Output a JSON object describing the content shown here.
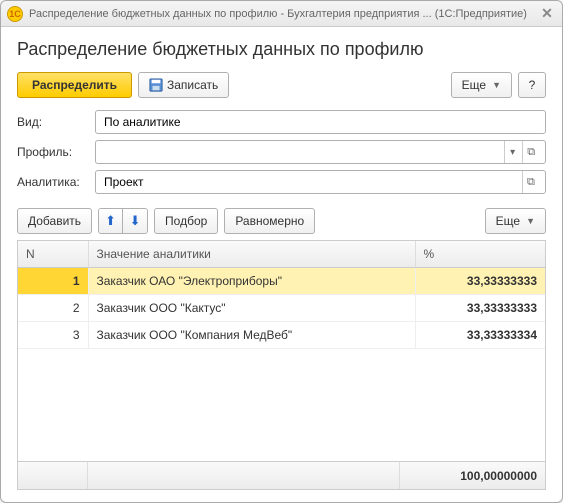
{
  "window": {
    "title": "Распределение бюджетных данных по профилю - Бухгалтерия предприятия ... (1С:Предприятие)",
    "logo_text": "1C"
  },
  "page": {
    "title": "Распределение бюджетных данных по профилю"
  },
  "toolbar": {
    "distribute": "Распределить",
    "save": "Записать",
    "more": "Еще",
    "help": "?"
  },
  "form": {
    "kind_label": "Вид:",
    "kind_value": "По аналитике",
    "profile_label": "Профиль:",
    "profile_value": "",
    "analytics_label": "Аналитика:",
    "analytics_value": "Проект"
  },
  "table_toolbar": {
    "add": "Добавить",
    "select": "Подбор",
    "evenly": "Равномерно",
    "more": "Еще"
  },
  "table": {
    "headers": {
      "n": "N",
      "value": "Значение аналитики",
      "pct": "%"
    },
    "rows": [
      {
        "n": "1",
        "value": "Заказчик ОАО \"Электроприборы\"",
        "pct": "33,33333333",
        "selected": true
      },
      {
        "n": "2",
        "value": "Заказчик ООО \"Кактус\"",
        "pct": "33,33333333",
        "selected": false
      },
      {
        "n": "3",
        "value": "Заказчик ООО \"Компания МедВеб\"",
        "pct": "33,33333334",
        "selected": false
      }
    ],
    "total_pct": "100,00000000"
  }
}
